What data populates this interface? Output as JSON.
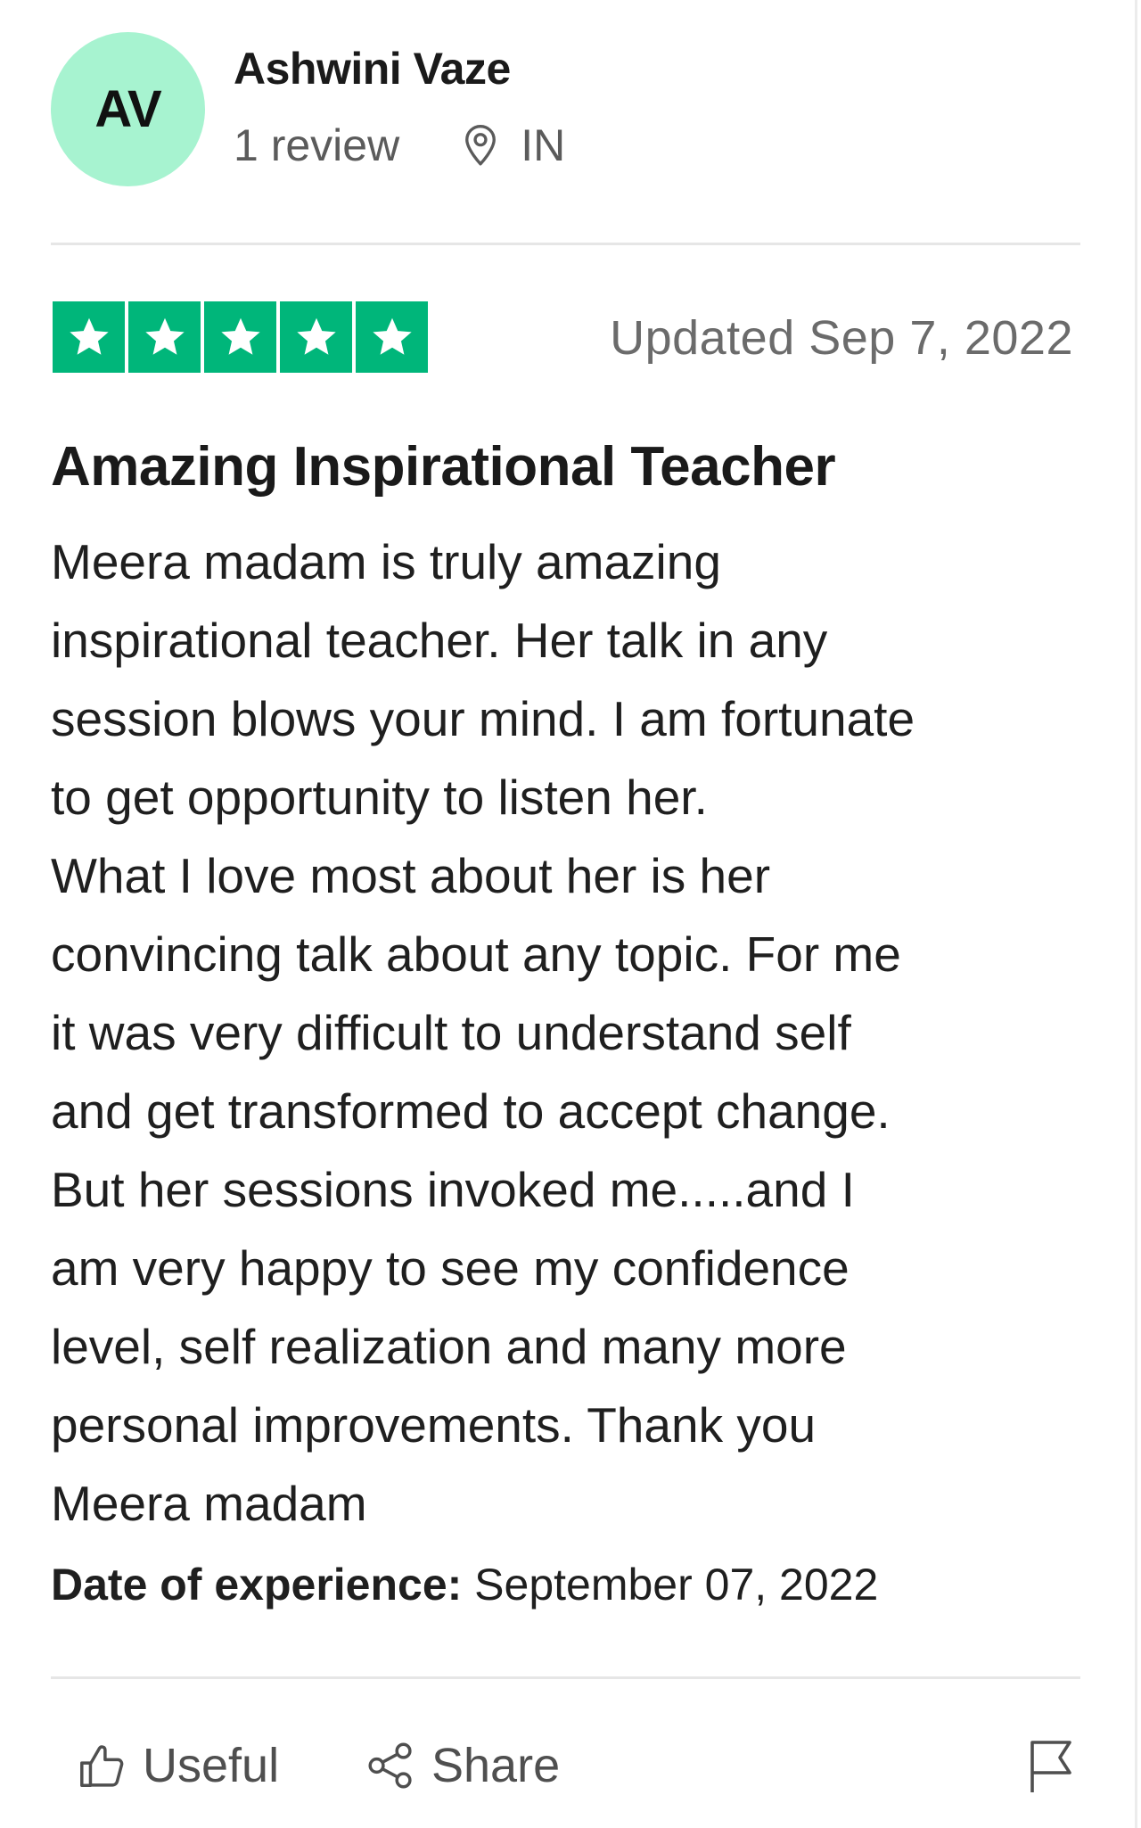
{
  "reviewer": {
    "initials": "AV",
    "name": "Ashwini Vaze",
    "review_count": "1 review",
    "location": "IN",
    "avatar_color": "#a7f3d0"
  },
  "rating": {
    "stars": 5,
    "max_stars": 5,
    "star_color": "#00b67a",
    "date": "Updated Sep 7, 2022"
  },
  "review": {
    "title": "Amazing Inspirational Teacher",
    "lines": [
      "Meera madam is truly amazing",
      "inspirational teacher. Her talk in any",
      "session blows your mind. I am fortunate",
      "to get opportunity to listen her.",
      "What I love most about her is her",
      "convincing talk about any topic. For me",
      "it was very difficult to understand self",
      "and get transformed to accept change.",
      "But her sessions invoked me.....and I",
      "am very happy to see my confidence",
      "level, self realization and many more",
      "personal improvements. Thank you",
      "Meera madam"
    ],
    "experience_label": "Date of experience:",
    "experience_date": " September 07, 2022"
  },
  "actions": {
    "useful_label": "Useful",
    "share_label": "Share",
    "icons": [
      "thumbs-up-icon",
      "share-icon",
      "flag-icon",
      "location-pin-icon",
      "star-icon"
    ]
  }
}
